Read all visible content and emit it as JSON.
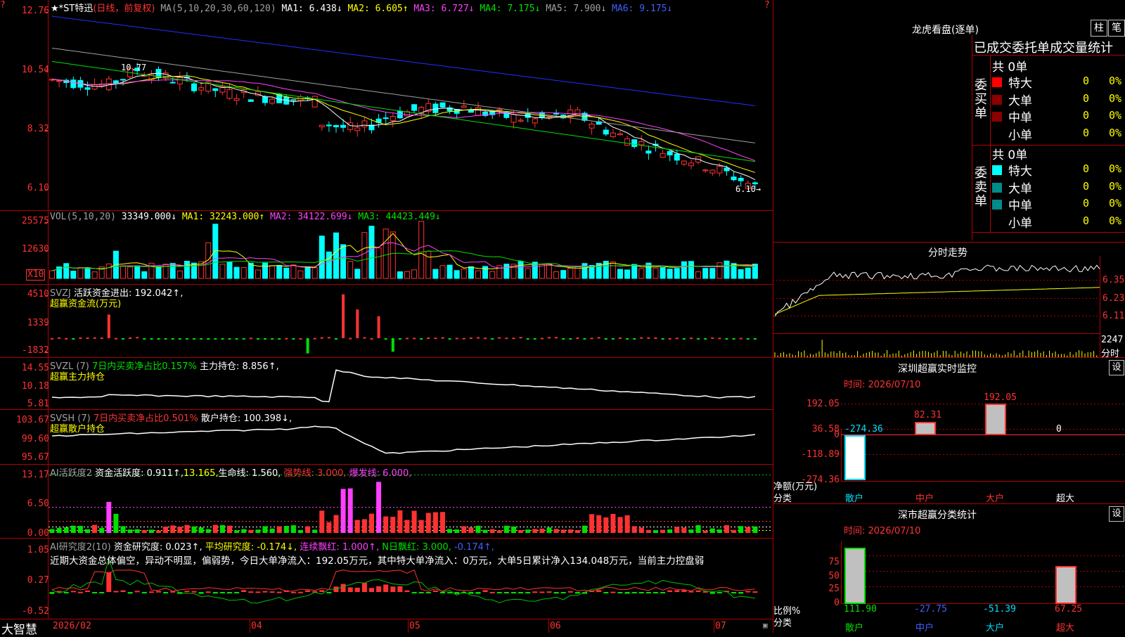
{
  "main": {
    "stock_name": "★*ST特迅",
    "mode": "(日线，前复权)",
    "ma_label": "MA(5,10,20,30,60,120)",
    "ma1": "MA1: 6.438↓",
    "ma2": "MA2: 6.605↑",
    "ma3": "MA3: 6.727↓",
    "ma4": "MA4: 7.175↓",
    "ma5": "MA5: 7.900↓",
    "ma6": "MA6: 9.175↓",
    "y_ticks": [
      "12.76",
      "10.54",
      "8.32",
      "6.10"
    ],
    "high_label": "10.77",
    "low_label": "6.10→"
  },
  "vol": {
    "title": "VOL(5,10,20)",
    "value": "33349.000↓",
    "ma1": "MA1: 32243.000↑",
    "ma2": "MA2: 34122.699↓",
    "ma3": "MA3: 44423.449↓",
    "y_ticks": [
      "25575",
      "12630"
    ],
    "unit": "X10"
  },
  "svzj": {
    "title": "SVZJ",
    "desc": "活跃资金进出: 192.042↑,",
    "sub": "超赢资金流(万元)",
    "y_ticks": [
      "4510",
      "1339",
      "-1832"
    ]
  },
  "svzl": {
    "title": "SVZL (7)",
    "desc": "7日内买卖净占比0.157%",
    "extra": "主力持仓: 8.856↑,",
    "sub": "超赢主力持仓",
    "y_ticks": [
      "14.55",
      "10.18",
      "5.81"
    ]
  },
  "svsh": {
    "title": "SVSH (7)",
    "desc": "7日内买卖净占比0.501%",
    "extra": "散户持仓: 100.398↓,",
    "sub": "超赢散户持仓",
    "y_ticks": [
      "103.67",
      "99.60",
      "95.67"
    ]
  },
  "ai1": {
    "title": "AI活跃度2",
    "a": "资金活跃度: 0.911↑,",
    "b": "13.165,",
    "c": "生命线: 1.560,",
    "d": "强势线: 3.000,",
    "e": "爆发线: 6.000,",
    "y_ticks": [
      "13.17",
      "6.50",
      "0.00"
    ]
  },
  "ai2": {
    "title": "AI研究度2(10)",
    "a": "资金研究度: 0.023↑,",
    "b": "平均研究度: -0.174↓,",
    "c": "连续飘红: 1.000↑,",
    "d": "N日飘红: 3.000,",
    "e": "-0.174↑,",
    "text": "近期大资金总体偏空，异动不明显，偏弱势，今日大单净流入：192.05万元，其中特大单净流入：0万元，大单5日累计净入134.048万元，当前主力控盘弱",
    "y_ticks": [
      "1.05",
      "0.27",
      "-0.52"
    ]
  },
  "xaxis": {
    "logo": "大智慧",
    "labels": [
      "2026/02",
      "04",
      "05",
      "06",
      "07"
    ]
  },
  "right": {
    "title": "龙虎看盘(逐单)",
    "btn_zhu": "柱",
    "btn_bi": "笔",
    "stats_title": "已成交委托单成交量统计",
    "buy_side": "委买单",
    "sell_side": "委卖单",
    "buy_total": "共 0单",
    "sell_total": "共 0单",
    "rows": [
      {
        "label": "特大",
        "count": "0",
        "pct": "0%"
      },
      {
        "label": "大单",
        "count": "0",
        "pct": "0%"
      },
      {
        "label": "中单",
        "count": "0",
        "pct": "0%"
      },
      {
        "label": "小单",
        "count": "0",
        "pct": "0%"
      }
    ],
    "buy_colors": [
      "#ff0000",
      "#8b0000",
      "#8b0000",
      "#000000"
    ],
    "sell_colors": [
      "#00ffff",
      "#008b8b",
      "#008b8b",
      "#000000"
    ],
    "intraday_title": "分时走势",
    "intraday_ticks": [
      "6.35",
      "6.23",
      "6.11"
    ],
    "intraday_vol": "2247",
    "intraday_unit": "分时",
    "sz_monitor_title": "深圳超赢实时监控",
    "sz_set": "设",
    "sz_time": "时间: 2026/07/10",
    "sz_ticks": [
      "192.05",
      "36.58",
      "0",
      "-118.89",
      "-274.36"
    ],
    "sz_values": [
      "-274.36",
      "82.31",
      "192.05",
      "0"
    ],
    "sz_ylabel": "净额(万元)",
    "sz_xlabel": "分类",
    "sz_cats": [
      "散户",
      "中户",
      "大户",
      "超大"
    ],
    "sc_title": "深市超赢分类统计",
    "sc_set": "设",
    "sc_time": "时间: 2026/07/10",
    "sc_ticks": [
      "75",
      "50",
      "25",
      "0"
    ],
    "sc_values": [
      "111.90",
      "-27.75",
      "-51.39",
      "67.25"
    ],
    "sc_ylabel": "比例%",
    "sc_xlabel": "分类",
    "sc_cats": [
      "散户",
      "中户",
      "大户",
      "超大"
    ]
  }
}
